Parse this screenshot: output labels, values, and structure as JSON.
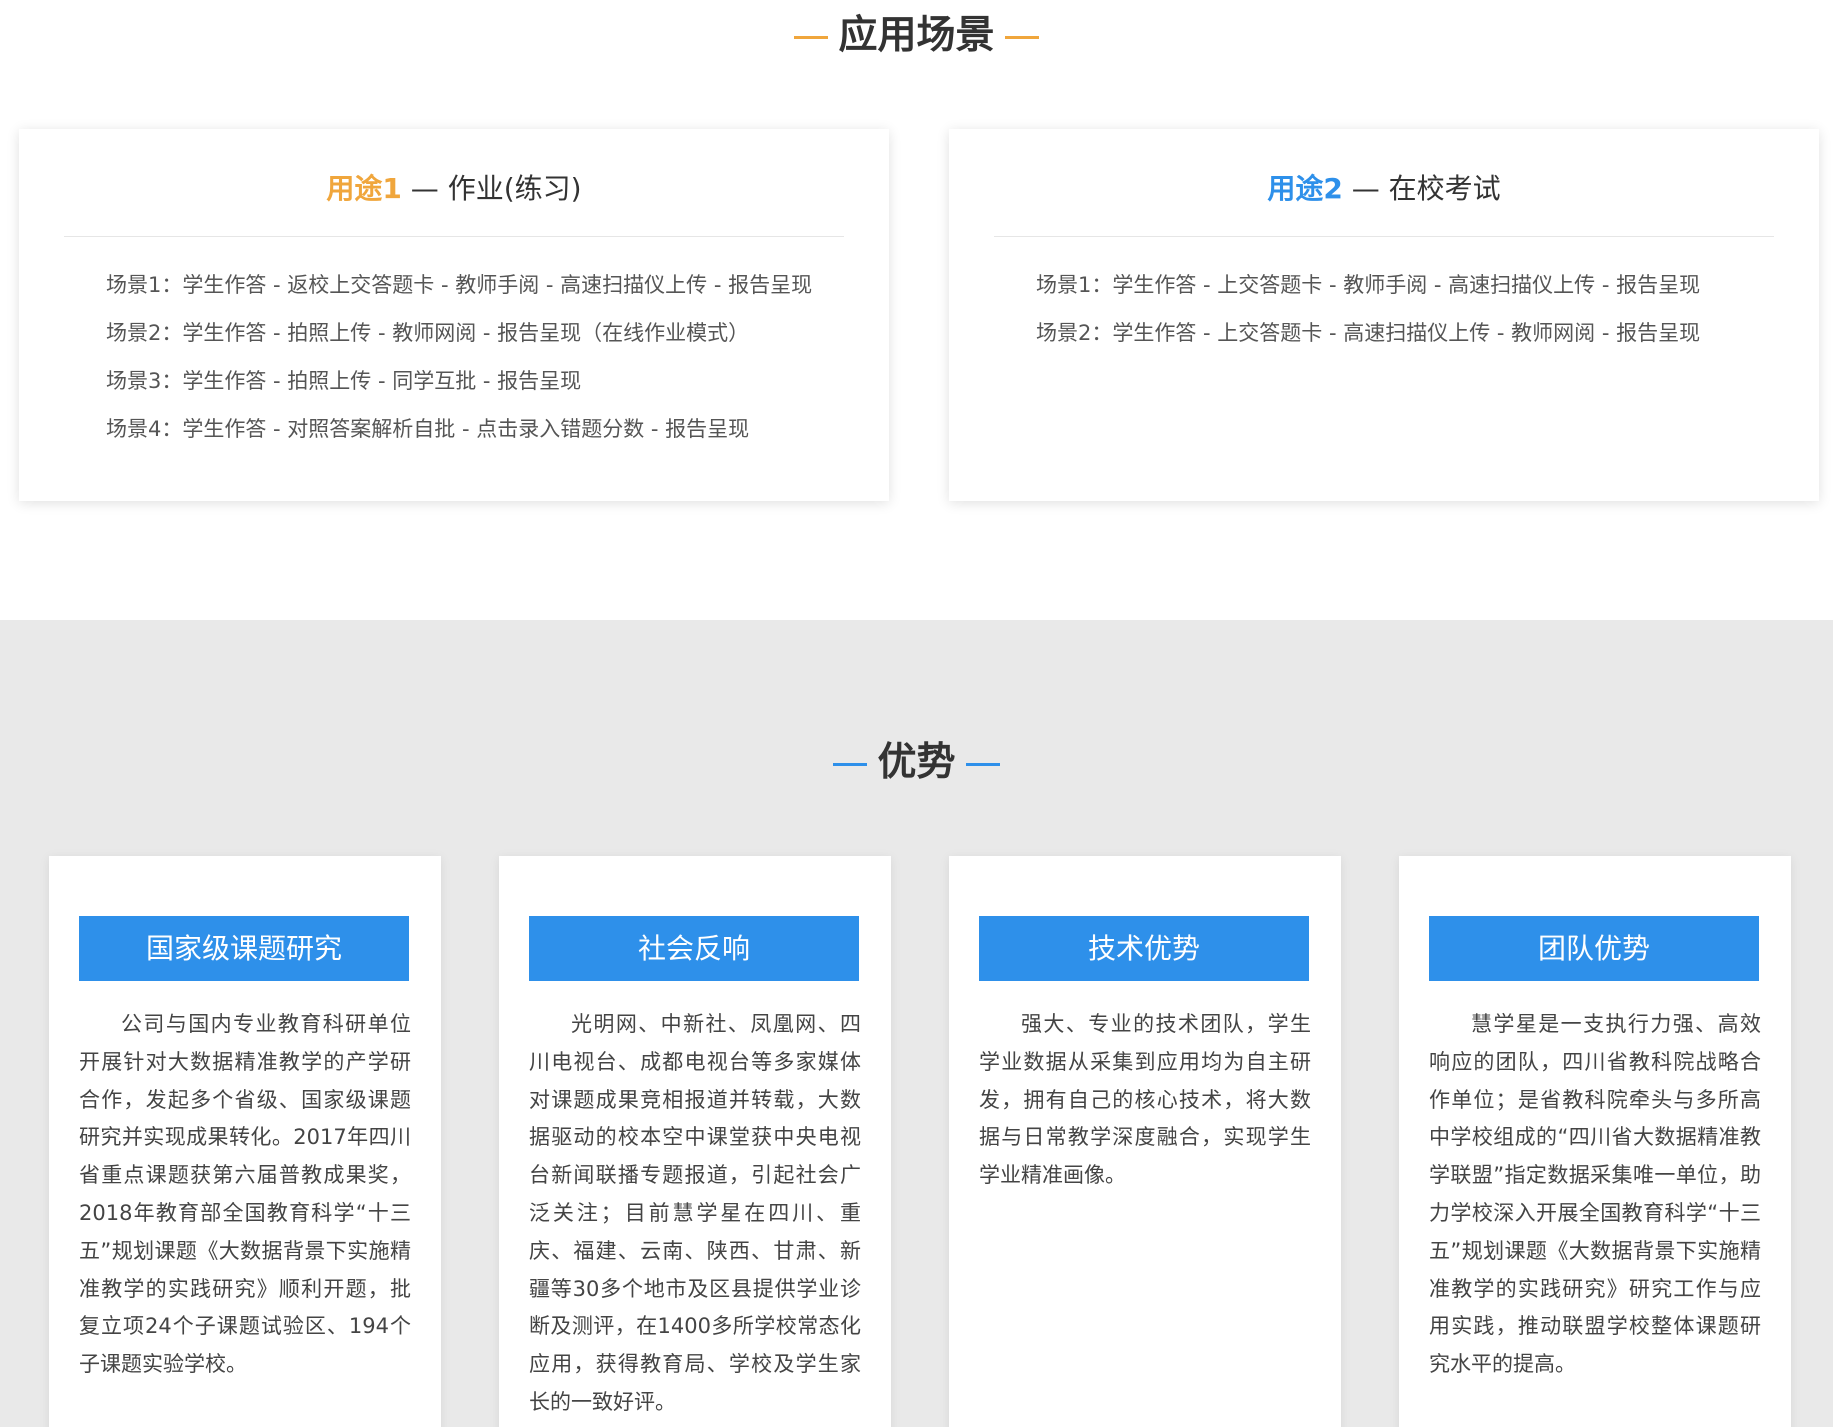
{
  "scenarios": {
    "title": "应用场景",
    "uses": [
      {
        "tag": "用途1",
        "sep": " — ",
        "name": "作业(练习)",
        "items": [
          "场景1：学生作答 - 返校上交答题卡 - 教师手阅 - 高速扫描仪上传 - 报告呈现",
          "场景2：学生作答 - 拍照上传 - 教师网阅 - 报告呈现（在线作业模式）",
          "场景3：学生作答 - 拍照上传 - 同学互批 - 报告呈现",
          "场景4：学生作答 - 对照答案解析自批 - 点击录入错题分数 - 报告呈现"
        ]
      },
      {
        "tag": "用途2",
        "sep": " — ",
        "name": "在校考试",
        "items": [
          "场景1：学生作答 - 上交答题卡 - 教师手阅 - 高速扫描仪上传 - 报告呈现",
          "场景2：学生作答 - 上交答题卡 - 高速扫描仪上传 - 教师网阅 - 报告呈现"
        ]
      }
    ]
  },
  "advantages": {
    "title": "优势",
    "cards": [
      {
        "button": "国家级课题研究",
        "text": "公司与国内专业教育科研单位开展针对大数据精准教学的产学研合作，发起多个省级、国家级课题研究并实现成果转化。2017年四川省重点课题获第六届普教成果奖，2018年教育部全国教育科学“十三五”规划课题《大数据背景下实施精准教学的实践研究》顺利开题，批复立项24个子课题试验区、194个子课题实验学校。"
      },
      {
        "button": "社会反响",
        "text": "光明网、中新社、凤凰网、四川电视台、成都电视台等多家媒体对课题成果竞相报道并转载，大数据驱动的校本空中课堂获中央电视台新闻联播专题报道，引起社会广泛关注；目前慧学星在四川、重庆、福建、云南、陕西、甘肃、新疆等30多个地市及区县提供学业诊断及测评，在1400多所学校常态化应用，获得教育局、学校及学生家长的一致好评。"
      },
      {
        "button": "技术优势",
        "text": "强大、专业的技术团队，学生学业数据从采集到应用均为自主研发，拥有自己的核心技术，将大数据与日常教学深度融合，实现学生学业精准画像。"
      },
      {
        "button": "团队优势",
        "text": "慧学星是一支执行力强、高效响应的团队，四川省教科院战略合作单位；是省教科院牵头与多所高中学校组成的“四川省大数据精准教学联盟”指定数据采集唯一单位，助力学校深入开展全国教育科学“十三五”规划课题《大数据背景下实施精准教学的实践研究》研究工作与应用实践，推动联盟学校整体课题研究水平的提高。"
      }
    ]
  },
  "colors": {
    "orange": "#f0a63c",
    "blue": "#2e90ea",
    "gray_bg": "#e9e9e9"
  }
}
